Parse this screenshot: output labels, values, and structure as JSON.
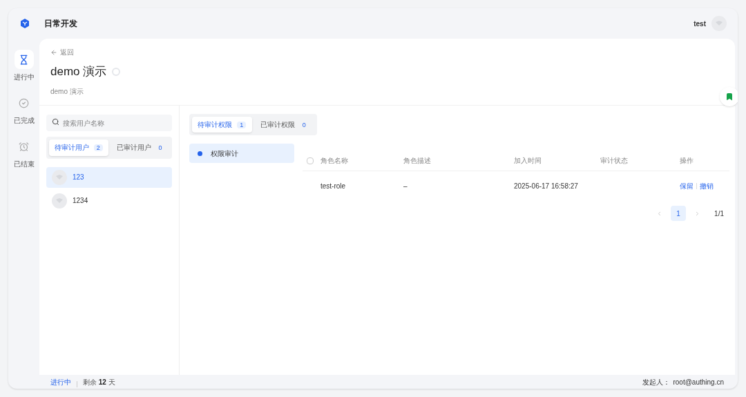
{
  "app": {
    "title": "日常开发",
    "user": "test"
  },
  "nav": [
    {
      "label": "进行中",
      "selected": true,
      "kind": "hourglass"
    },
    {
      "label": "已完成",
      "selected": false,
      "kind": "check"
    },
    {
      "label": "已结束",
      "selected": false,
      "kind": "clock"
    }
  ],
  "back": "返回",
  "title": "demo 演示",
  "subtitle": "demo 演示",
  "search": {
    "placeholder": "搜索用户名称"
  },
  "user_tabs": [
    {
      "label": "待审计用户",
      "count": "2",
      "selected": true
    },
    {
      "label": "已审计用户",
      "count": "0",
      "selected": false
    }
  ],
  "users": [
    {
      "name": "123",
      "selected": true
    },
    {
      "name": "1234",
      "selected": false
    }
  ],
  "perm_tabs": [
    {
      "label": "待审计权限",
      "count": "1",
      "selected": true
    },
    {
      "label": "已审计权限",
      "count": "0",
      "selected": false
    }
  ],
  "categories": [
    {
      "label": "权限审计",
      "selected": true
    }
  ],
  "table": {
    "select_all": {
      "checked": false
    },
    "columns": [
      "角色名称",
      "角色描述",
      "加入时间",
      "审计状态",
      "操作"
    ],
    "rows": [
      {
        "cells": [
          "test-role",
          "–",
          "2025-06-17 16:58:27",
          ""
        ],
        "actions": [
          "保留",
          "撤销"
        ]
      }
    ]
  },
  "pagination": {
    "pages": [
      {
        "label": "1",
        "selected": true
      }
    ],
    "total": "1/1"
  },
  "footer": {
    "status": "进行中",
    "remaining_label": "剩余",
    "remaining": "12",
    "unit": "天",
    "initiator_label": "发起人：",
    "initiator": "root@authing.cn"
  }
}
